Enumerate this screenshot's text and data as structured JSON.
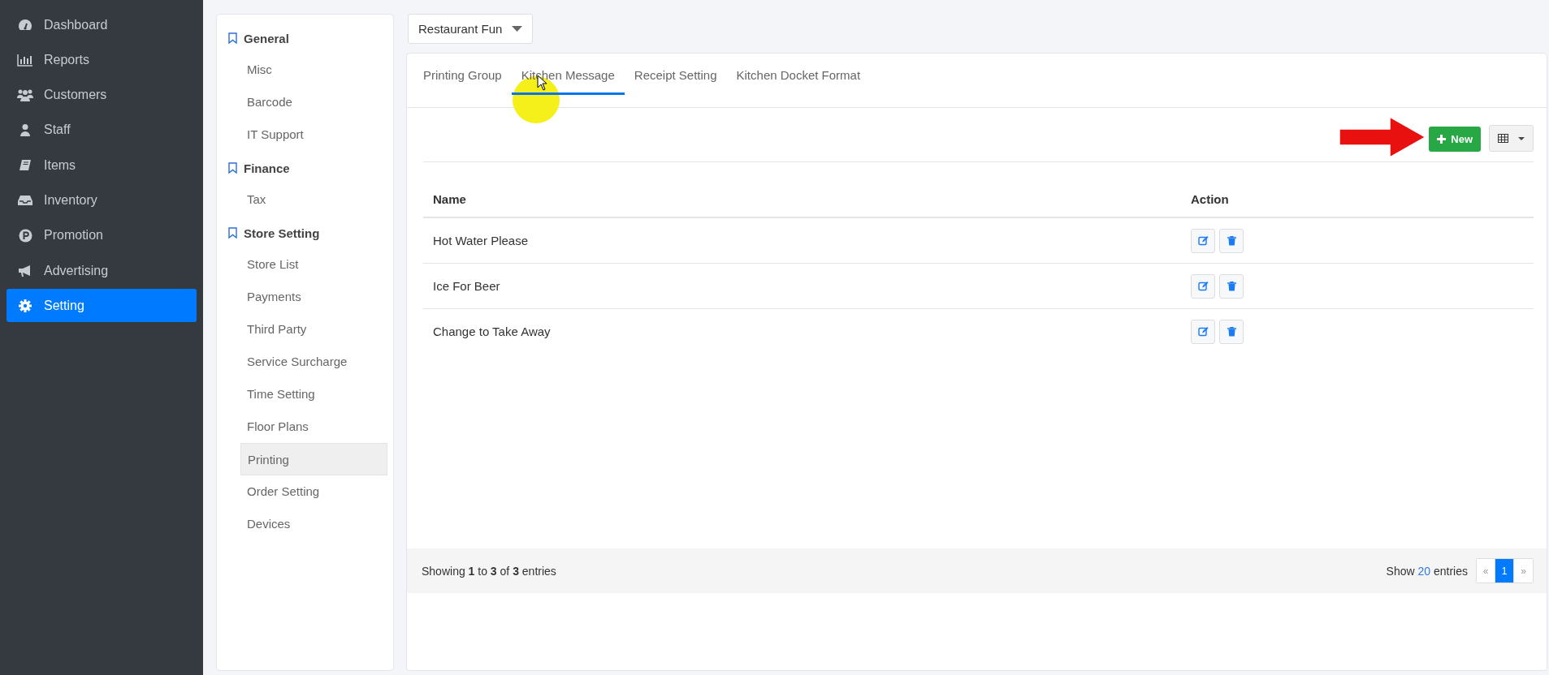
{
  "sidebar": {
    "items": [
      {
        "label": "Dashboard",
        "selected": false
      },
      {
        "label": "Reports",
        "selected": false
      },
      {
        "label": "Customers",
        "selected": false
      },
      {
        "label": "Staff",
        "selected": false
      },
      {
        "label": "Items",
        "selected": false
      },
      {
        "label": "Inventory",
        "selected": false
      },
      {
        "label": "Promotion",
        "selected": false
      },
      {
        "label": "Advertising",
        "selected": false
      },
      {
        "label": "Setting",
        "selected": true
      }
    ]
  },
  "settings_menu": {
    "groups": [
      {
        "heading": "General",
        "items": [
          {
            "label": "Misc",
            "selected": false
          },
          {
            "label": "Barcode",
            "selected": false
          },
          {
            "label": "IT Support",
            "selected": false
          }
        ]
      },
      {
        "heading": "Finance",
        "items": [
          {
            "label": "Tax",
            "selected": false
          }
        ]
      },
      {
        "heading": "Store Setting",
        "items": [
          {
            "label": "Store List",
            "selected": false
          },
          {
            "label": "Payments",
            "selected": false
          },
          {
            "label": "Third Party",
            "selected": false
          },
          {
            "label": "Service Surcharge",
            "selected": false
          },
          {
            "label": "Time Setting",
            "selected": false
          },
          {
            "label": "Floor Plans",
            "selected": false
          },
          {
            "label": "Printing",
            "selected": true
          },
          {
            "label": "Order Setting",
            "selected": false
          },
          {
            "label": "Devices",
            "selected": false
          }
        ]
      }
    ]
  },
  "store_select": {
    "value": "Restaurant Fun"
  },
  "tabs": [
    {
      "label": "Printing Group",
      "selected": false
    },
    {
      "label": "Kitchen Message",
      "selected": true
    },
    {
      "label": "Receipt Setting",
      "selected": false
    },
    {
      "label": "Kitchen Docket Format",
      "selected": false
    }
  ],
  "toolbar": {
    "new_button": "New"
  },
  "table": {
    "columns": [
      "Name",
      "Action"
    ],
    "rows": [
      {
        "name": "Hot Water Please"
      },
      {
        "name": "Ice For Beer"
      },
      {
        "name": "Change to Take Away"
      }
    ]
  },
  "footer": {
    "summary": "Showing **1** to **3** of **3** entries",
    "show_prefix": "Show",
    "page_size": "20",
    "show_suffix": "entries",
    "pagination": [
      {
        "label": "«",
        "selected": false
      },
      {
        "label": "1",
        "selected": true
      },
      {
        "label": "»",
        "selected": false
      }
    ]
  }
}
